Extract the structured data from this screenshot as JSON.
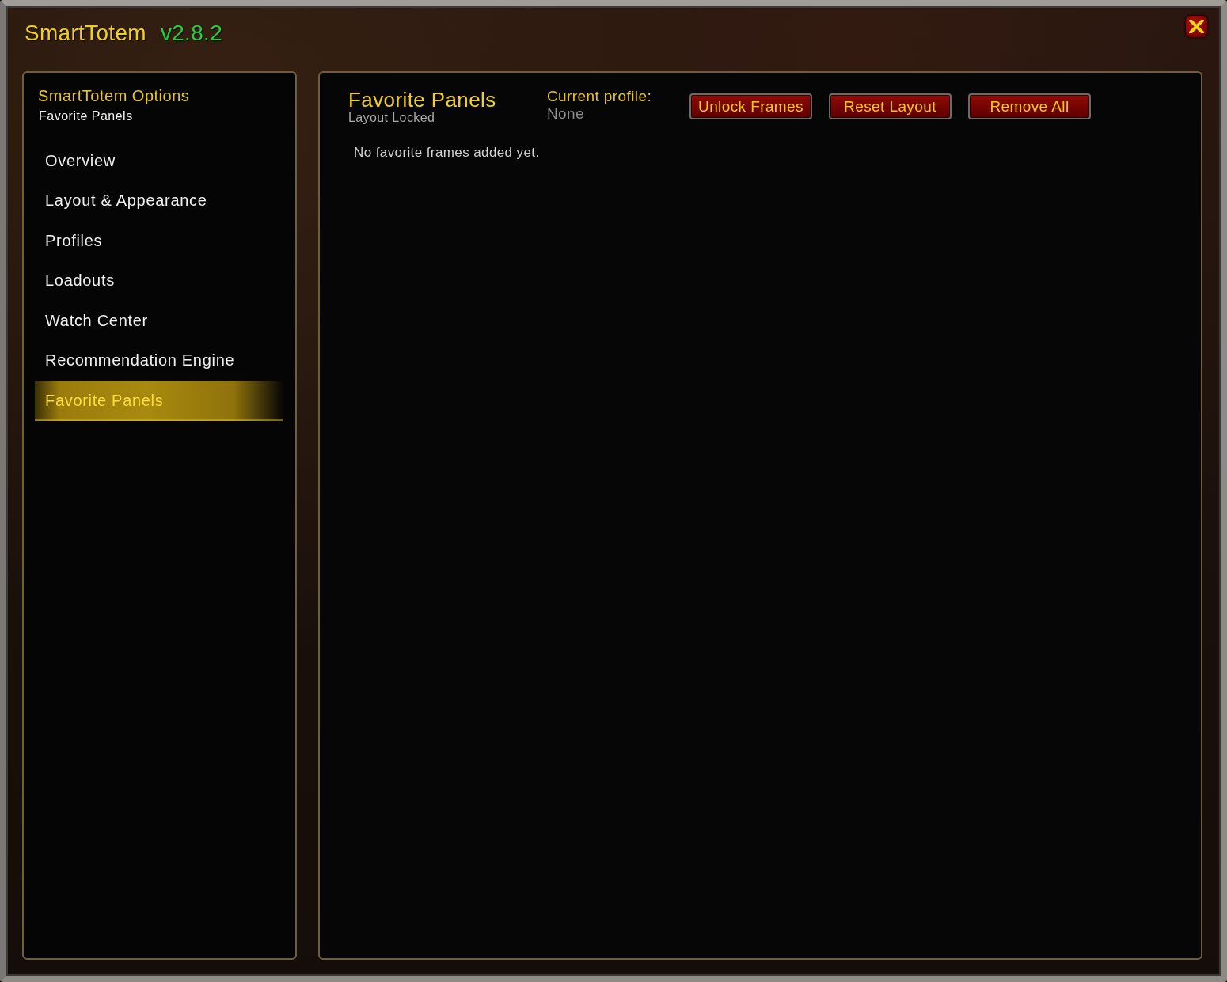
{
  "window": {
    "title": "SmartTotem",
    "version": "v2.8.2"
  },
  "sidebar": {
    "heading": "SmartTotem Options",
    "subheading": "Favorite Panels",
    "items": [
      {
        "label": "Overview",
        "selected": false
      },
      {
        "label": "Layout & Appearance",
        "selected": false
      },
      {
        "label": "Profiles",
        "selected": false
      },
      {
        "label": "Loadouts",
        "selected": false
      },
      {
        "label": "Watch Center",
        "selected": false
      },
      {
        "label": "Recommendation Engine",
        "selected": false
      },
      {
        "label": "Favorite Panels",
        "selected": true
      }
    ]
  },
  "content": {
    "title": "Favorite Panels",
    "status": "Layout Locked",
    "profile_label": "Current profile:",
    "profile_value": "None",
    "buttons": [
      "Unlock Frames",
      "Reset Layout",
      "Remove All"
    ],
    "empty_message": "No favorite frames added yet."
  }
}
